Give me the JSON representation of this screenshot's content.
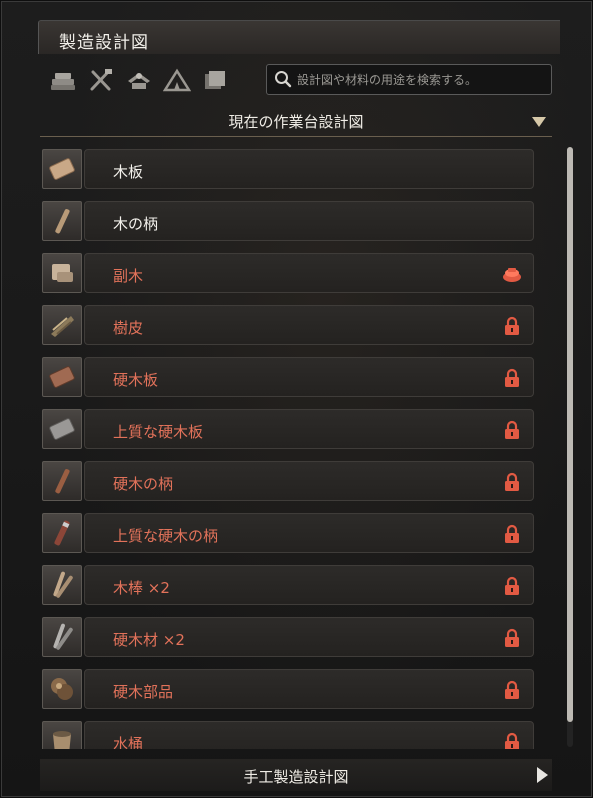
{
  "window": {
    "title": "製造設計図"
  },
  "categories": [
    {
      "icon": "lumber-stack-icon"
    },
    {
      "icon": "crossed-tools-icon"
    },
    {
      "icon": "crafting-station-icon"
    },
    {
      "icon": "tent-icon"
    },
    {
      "icon": "blueprint-stack-icon"
    }
  ],
  "search": {
    "placeholder": "設計図や材料の用途を検索する。",
    "value": ""
  },
  "dropdown": {
    "label": "現在の作業台設計図"
  },
  "items": [
    {
      "label": "木板",
      "icon": "wood-plank-icon",
      "locked": false,
      "status": ""
    },
    {
      "label": "木の柄",
      "icon": "wood-handle-icon",
      "locked": false,
      "status": ""
    },
    {
      "label": "副木",
      "icon": "splint-icon",
      "locked": true,
      "status": "missing-materials-icon"
    },
    {
      "label": "樹皮",
      "icon": "bark-icon",
      "locked": true,
      "status": "lock-icon"
    },
    {
      "label": "硬木板",
      "icon": "hardwood-plank-icon",
      "locked": true,
      "status": "lock-icon"
    },
    {
      "label": "上質な硬木板",
      "icon": "fine-hardwood-plank-icon",
      "locked": true,
      "status": "lock-icon"
    },
    {
      "label": "硬木の柄",
      "icon": "hardwood-handle-icon",
      "locked": true,
      "status": "lock-icon"
    },
    {
      "label": "上質な硬木の柄",
      "icon": "fine-hardwood-handle-icon",
      "locked": true,
      "status": "lock-icon"
    },
    {
      "label": "木棒 ×2",
      "icon": "wood-sticks-icon",
      "locked": true,
      "status": "lock-icon"
    },
    {
      "label": "硬木材 ×2",
      "icon": "hardwood-sticks-icon",
      "locked": true,
      "status": "lock-icon"
    },
    {
      "label": "硬木部品",
      "icon": "hardwood-parts-icon",
      "locked": true,
      "status": "lock-icon"
    },
    {
      "label": "水桶",
      "icon": "water-bucket-icon",
      "locked": true,
      "status": "lock-icon"
    }
  ],
  "footer": {
    "label": "手工製造設計図"
  },
  "colors": {
    "locked_text": "#e2725a",
    "unlocked_text": "#f3f1ec",
    "accent": "#d6c8a8"
  }
}
